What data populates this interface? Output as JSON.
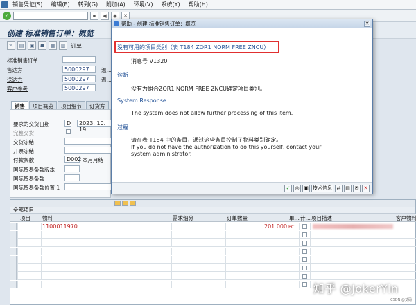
{
  "menubar": {
    "items": [
      "销售凭证(S)",
      "编辑(E)",
      "转到(G)",
      "附加(A)",
      "环境(V)",
      "系统(Y)",
      "帮助(H)"
    ]
  },
  "screen": {
    "title": "创建 标准销售订单：概览"
  },
  "app_toolbar": {
    "order_label": "订单"
  },
  "header": {
    "doc_type_label": "标准销售订单",
    "sold_to_label": "售达方",
    "sold_to_value": "5000297",
    "sold_to_desc": "温…",
    "ship_to_label": "送达方",
    "ship_to_value": "5000297",
    "ship_to_desc": "温…",
    "customer_ref_label": "客户参考",
    "customer_ref_value": "5000297"
  },
  "tabs": [
    "销售",
    "项目概览",
    "项目细节",
    "订货方"
  ],
  "sales_tab": {
    "req_date_label": "要求的交货日期",
    "req_date_type": "D",
    "req_date_value": "2023. 10. 19",
    "complete_label": "完整交货",
    "block_label": "交货冻结",
    "billing_block_label": "开票冻结",
    "payment_label": "付款条款",
    "payment_value": "D002",
    "payment_desc": "本月月结",
    "incoterms_version_label": "国际贸易条款版本",
    "incoterms_label": "国际贸易条款",
    "incoterms_loc_label": "国际贸易条款位置 1"
  },
  "items_grid": {
    "title": "全部项目",
    "columns": [
      "项目",
      "物料",
      "需求细分",
      "订单数量",
      "单…",
      "计…",
      "项目描述",
      "客户物料"
    ],
    "rows": [
      {
        "item": "",
        "material": "1100011970",
        "qty": "201.000",
        "unit": "PC"
      }
    ]
  },
  "dialog": {
    "title": "帮助 - 创建 标准销售订单：概览",
    "headline": "没有可用的项目类别（表 T184 ZOR1 NORM FREE ZNCU）",
    "msg_no": "消息号 V1320",
    "diag_title": "诊断",
    "diag_text": "没有为组合ZOR1 NORM FREE ZNCU确定项目类别。",
    "sysresp_title": "System Response",
    "sysresp_text": "The system does not allow further processing of this item.",
    "proc_title": "过程",
    "proc_line1": "请在表  T184 中的条目，通过这些条目控制了物料类别确定。",
    "proc_line2": "If you do not have the authorization to do this yourself, contact your",
    "proc_line3": "system administrator.",
    "tech_info": "技术信息"
  },
  "watermark": {
    "text": "知乎 @JokerYin",
    "small": "CSDN @艾码"
  }
}
